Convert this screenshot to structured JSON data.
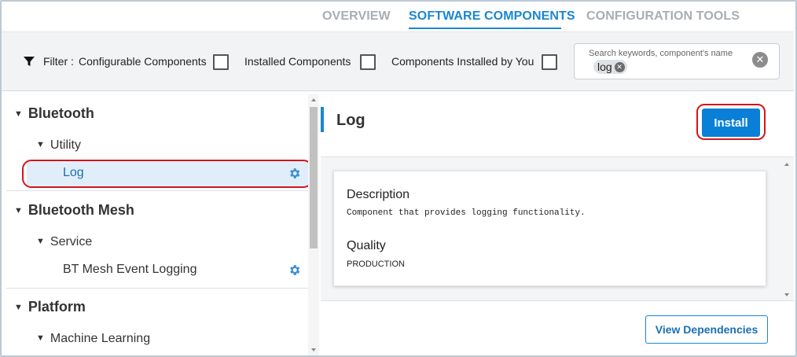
{
  "tabs": [
    {
      "label": "OVERVIEW",
      "active": false
    },
    {
      "label": "SOFTWARE COMPONENTS",
      "active": true
    },
    {
      "label": "CONFIGURATION TOOLS",
      "active": false
    }
  ],
  "filter": {
    "label": "Filter :",
    "options": [
      {
        "label": "Configurable Components",
        "checked": false
      },
      {
        "label": "Installed Components",
        "checked": false
      },
      {
        "label": "Components Installed by You",
        "checked": false
      }
    ],
    "search": {
      "placeholder": "Search keywords, component's name",
      "chip": "log"
    }
  },
  "tree": {
    "categories": [
      {
        "label": "Bluetooth",
        "groups": [
          {
            "label": "Utility",
            "items": [
              {
                "label": "Log",
                "selected": true
              }
            ]
          }
        ]
      },
      {
        "label": "Bluetooth Mesh",
        "groups": [
          {
            "label": "Service",
            "items": [
              {
                "label": "BT Mesh Event Logging",
                "selected": false
              }
            ]
          }
        ]
      },
      {
        "label": "Platform",
        "groups": [
          {
            "label": "Machine Learning",
            "items": []
          }
        ]
      }
    ]
  },
  "detail": {
    "title": "Log",
    "install_label": "Install",
    "description_heading": "Description",
    "description": "Component that provides logging functionality.",
    "quality_heading": "Quality",
    "quality": "PRODUCTION",
    "dependencies_label": "View Dependencies"
  },
  "colors": {
    "accent": "#1a87d2",
    "install": "#0a7fd8",
    "selected_row": "#e1eef9",
    "highlight_oval": "#d4151b"
  }
}
